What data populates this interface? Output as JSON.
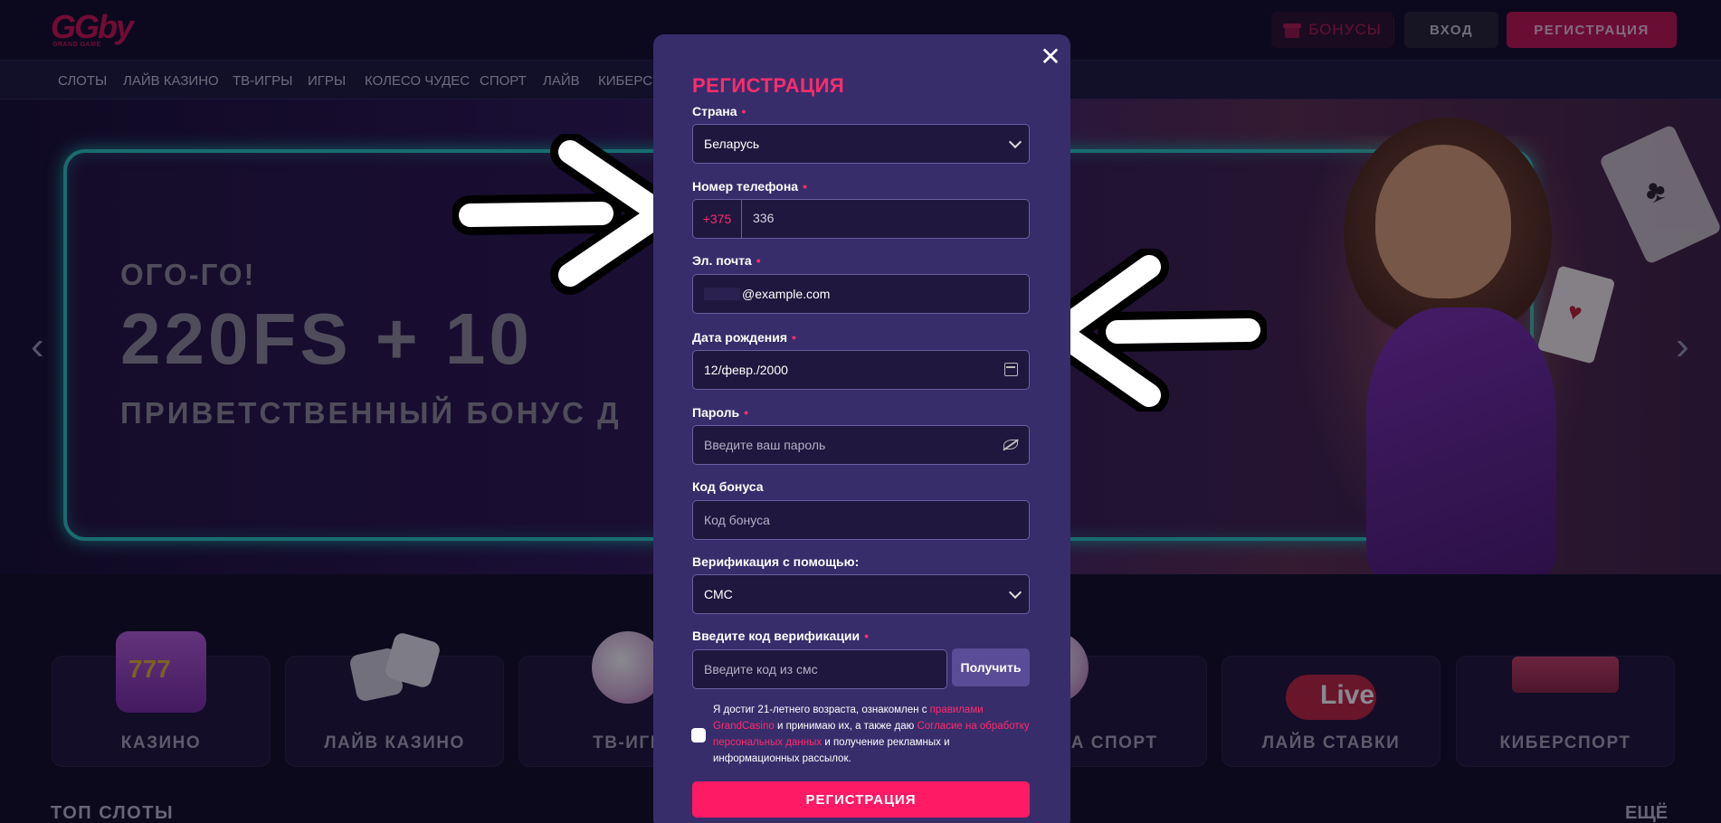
{
  "header": {
    "logo_text": "GGby",
    "logo_sub": "GRAND GAME",
    "bonus_label": "БОНУСЫ",
    "login_label": "ВХОД",
    "register_label": "РЕГИСТРАЦИЯ"
  },
  "nav": {
    "items": [
      "СЛОТЫ",
      "ЛАЙВ КАЗИНО",
      "ТВ-ИГРЫ",
      "ИГРЫ",
      "КОЛЕСО ЧУДЕС",
      "СПОРТ",
      "ЛАЙВ",
      "КИБЕРСП"
    ]
  },
  "hero": {
    "line1": "ОГО-ГО!",
    "line2": "220FS + 10",
    "line3": "ПРИВЕТСТВЕННЫЙ БОНУС Д"
  },
  "categories": [
    "КАЗИНО",
    "ЛАЙВ КАЗИНО",
    "ТВ-ИГР",
    "И НА СПОРТ",
    "ЛАЙВ СТАВКИ",
    "КИБЕРСПОРТ"
  ],
  "sections": {
    "top_slots": "ТОП СЛОТЫ",
    "more": "ЕЩЁ"
  },
  "modal": {
    "title": "РЕГИСТРАЦИЯ",
    "close_symbol": "✕",
    "country_label": "Страна",
    "country_value": "Беларусь",
    "phone_label": "Номер телефона",
    "phone_prefix": "+375",
    "phone_value": "336",
    "email_label": "Эл. почта",
    "email_value": "@example.com",
    "birth_label": "Дата рождения",
    "birth_value": "12/февр./2000",
    "password_label": "Пароль",
    "password_placeholder": "Введите ваш пароль",
    "bonus_code_label": "Код бонуса",
    "bonus_code_placeholder": "Код бонуса",
    "verification_label": "Верификация с помощью:",
    "verification_value": "СМС",
    "verify_code_label": "Введите код верификации",
    "verify_code_placeholder": "Введите код из смс",
    "get_button": "Получить",
    "agree_text_1": "Я достиг 21-летнего возраста, ознакомлен с ",
    "agree_link_1": "правилами GrandCasino",
    "agree_text_2": " и принимаю их, а также даю ",
    "agree_link_2": "Согласие на обработку персональных данных",
    "agree_text_3": " и получение рекламных и информационных рассылок.",
    "submit_label": "РЕГИСТРАЦИЯ"
  },
  "colors": {
    "accent": "#ff1a66",
    "modal_bg": "#372d6b",
    "page_bg": "#0e0b22"
  }
}
